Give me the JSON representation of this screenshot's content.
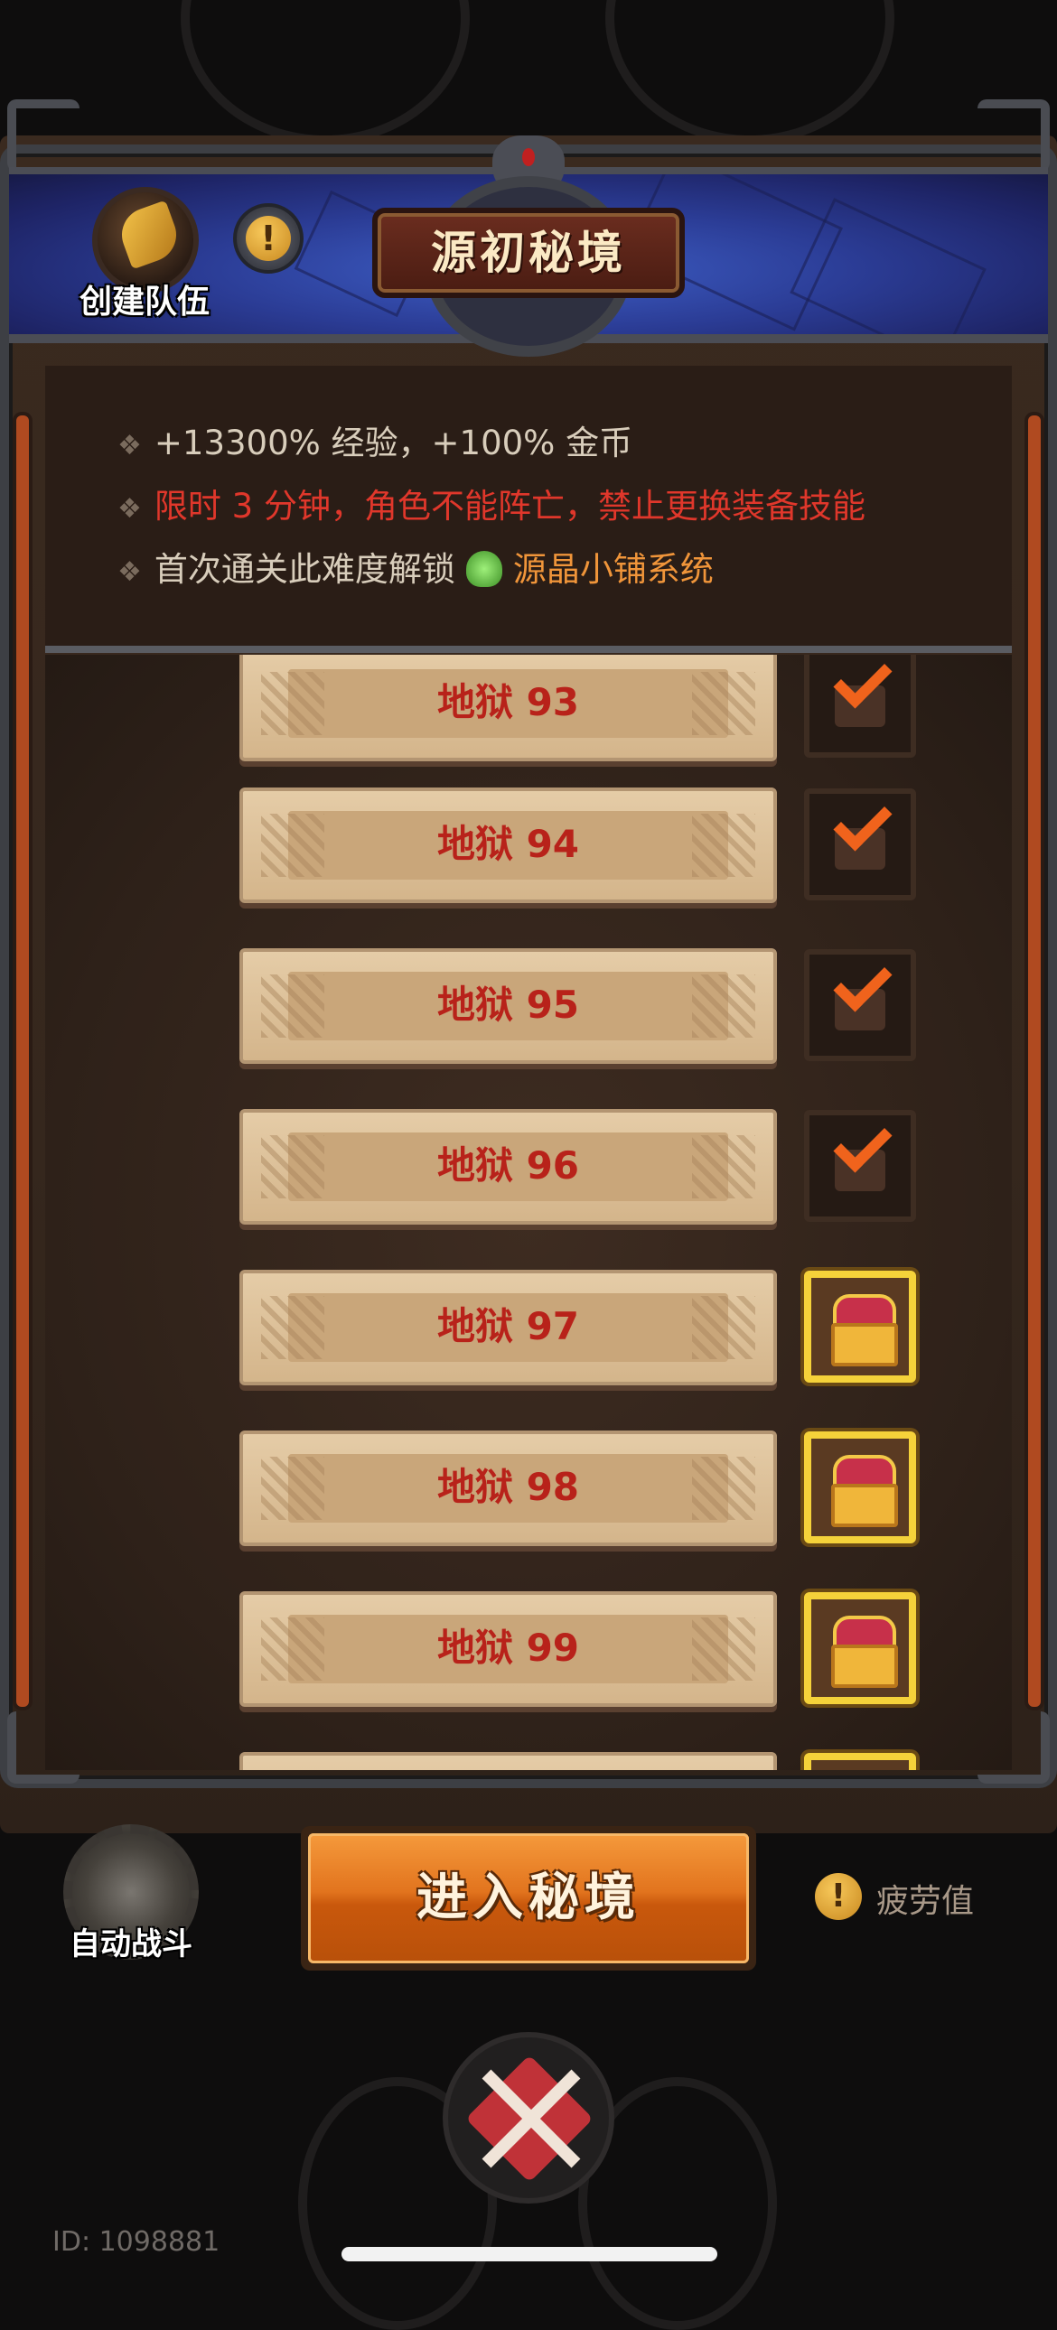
{
  "header": {
    "title": "源初秘境",
    "create_team_label": "创建队伍",
    "info_symbol": "!"
  },
  "rules": [
    {
      "text": "+13300% 经验，+100% 金币",
      "color": "normal"
    },
    {
      "text": "限时 3 分钟，角色不能阵亡，禁止更换装备技能",
      "color": "red"
    },
    {
      "prefix": "首次通关此难度解锁",
      "highlight": "源晶小铺系统"
    }
  ],
  "rule_bullet": "❖",
  "levels": [
    {
      "label": "地狱 93",
      "reward_state": "claimed"
    },
    {
      "label": "地狱 94",
      "reward_state": "claimed"
    },
    {
      "label": "地狱 95",
      "reward_state": "claimed"
    },
    {
      "label": "地狱 96",
      "reward_state": "claimed"
    },
    {
      "label": "地狱 97",
      "reward_state": "available"
    },
    {
      "label": "地狱 98",
      "reward_state": "available"
    },
    {
      "label": "地狱 99",
      "reward_state": "available"
    },
    {
      "label": "",
      "reward_state": "available"
    }
  ],
  "actions": {
    "auto_battle_label": "自动战斗",
    "enter_label": "进入秘境",
    "fatigue_label": "疲劳值",
    "fatigue_symbol": "!"
  },
  "footer": {
    "player_id": "ID: 1098881"
  },
  "colors": {
    "accent_red": "#e0372b",
    "accent_orange": "#f0953a",
    "enter_button": "#e2741e",
    "chest_border": "#f5d23a"
  }
}
